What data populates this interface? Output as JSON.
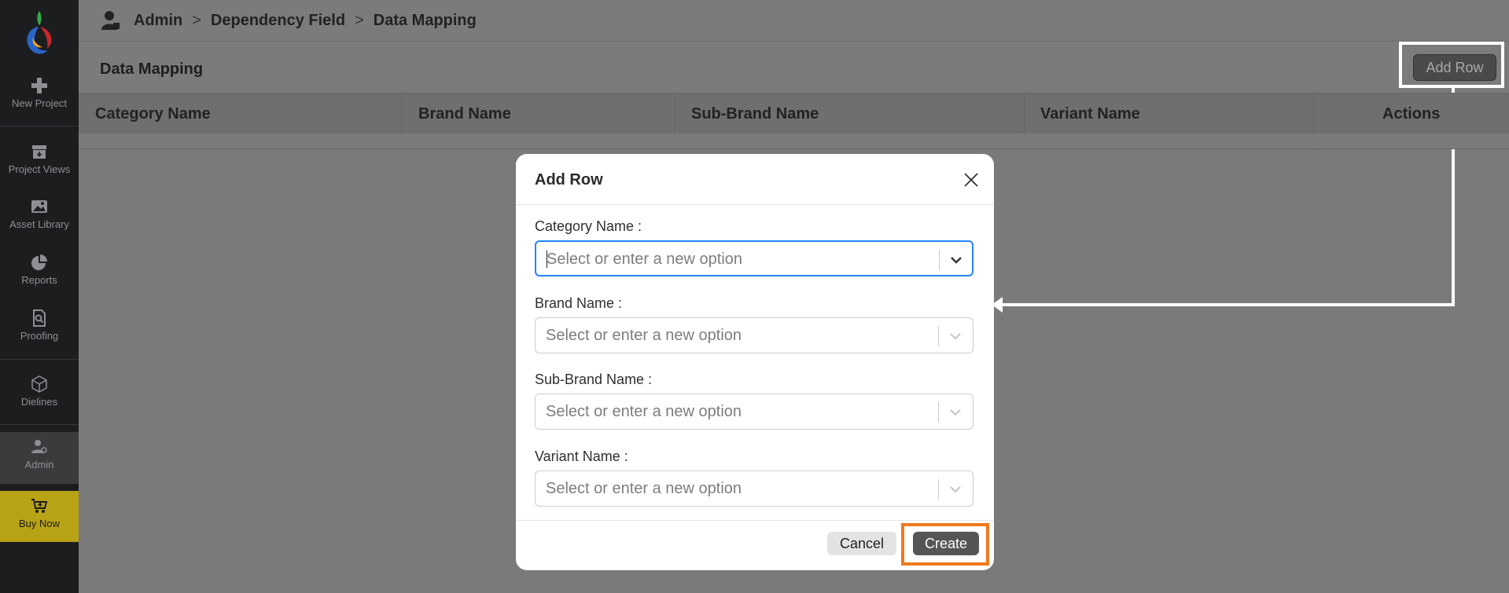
{
  "sidebar": {
    "items": [
      {
        "label": "New Project",
        "icon": "plus-icon"
      },
      {
        "label": "Project Views",
        "icon": "archive-icon"
      },
      {
        "label": "Asset Library",
        "icon": "image-icon"
      },
      {
        "label": "Reports",
        "icon": "pie-chart-icon"
      },
      {
        "label": "Proofing",
        "icon": "proof-search-icon"
      },
      {
        "label": "Dielines",
        "icon": "box-icon"
      },
      {
        "label": "Admin",
        "icon": "admin-user-icon"
      },
      {
        "label": "Buy Now",
        "icon": "cart-icon"
      }
    ],
    "buy_color": "#b8a216"
  },
  "breadcrumb": {
    "items": [
      "Admin",
      "Dependency Field",
      "Data Mapping"
    ],
    "separator": ">"
  },
  "page": {
    "title": "Data Mapping",
    "add_row_label": "Add Row"
  },
  "table": {
    "columns": [
      "Category Name",
      "Brand Name",
      "Sub-Brand Name",
      "Variant Name",
      "Actions"
    ]
  },
  "modal": {
    "title": "Add Row",
    "fields": [
      {
        "label": "Category Name :",
        "placeholder": "Select or enter a new option"
      },
      {
        "label": "Brand Name :",
        "placeholder": "Select or enter a new option"
      },
      {
        "label": "Sub-Brand Name :",
        "placeholder": "Select or enter a new option"
      },
      {
        "label": "Variant Name :",
        "placeholder": "Select or enter a new option"
      }
    ],
    "cancel_label": "Cancel",
    "create_label": "Create",
    "focus_color": "#2684ff",
    "highlight_color": "#f07a1e"
  }
}
